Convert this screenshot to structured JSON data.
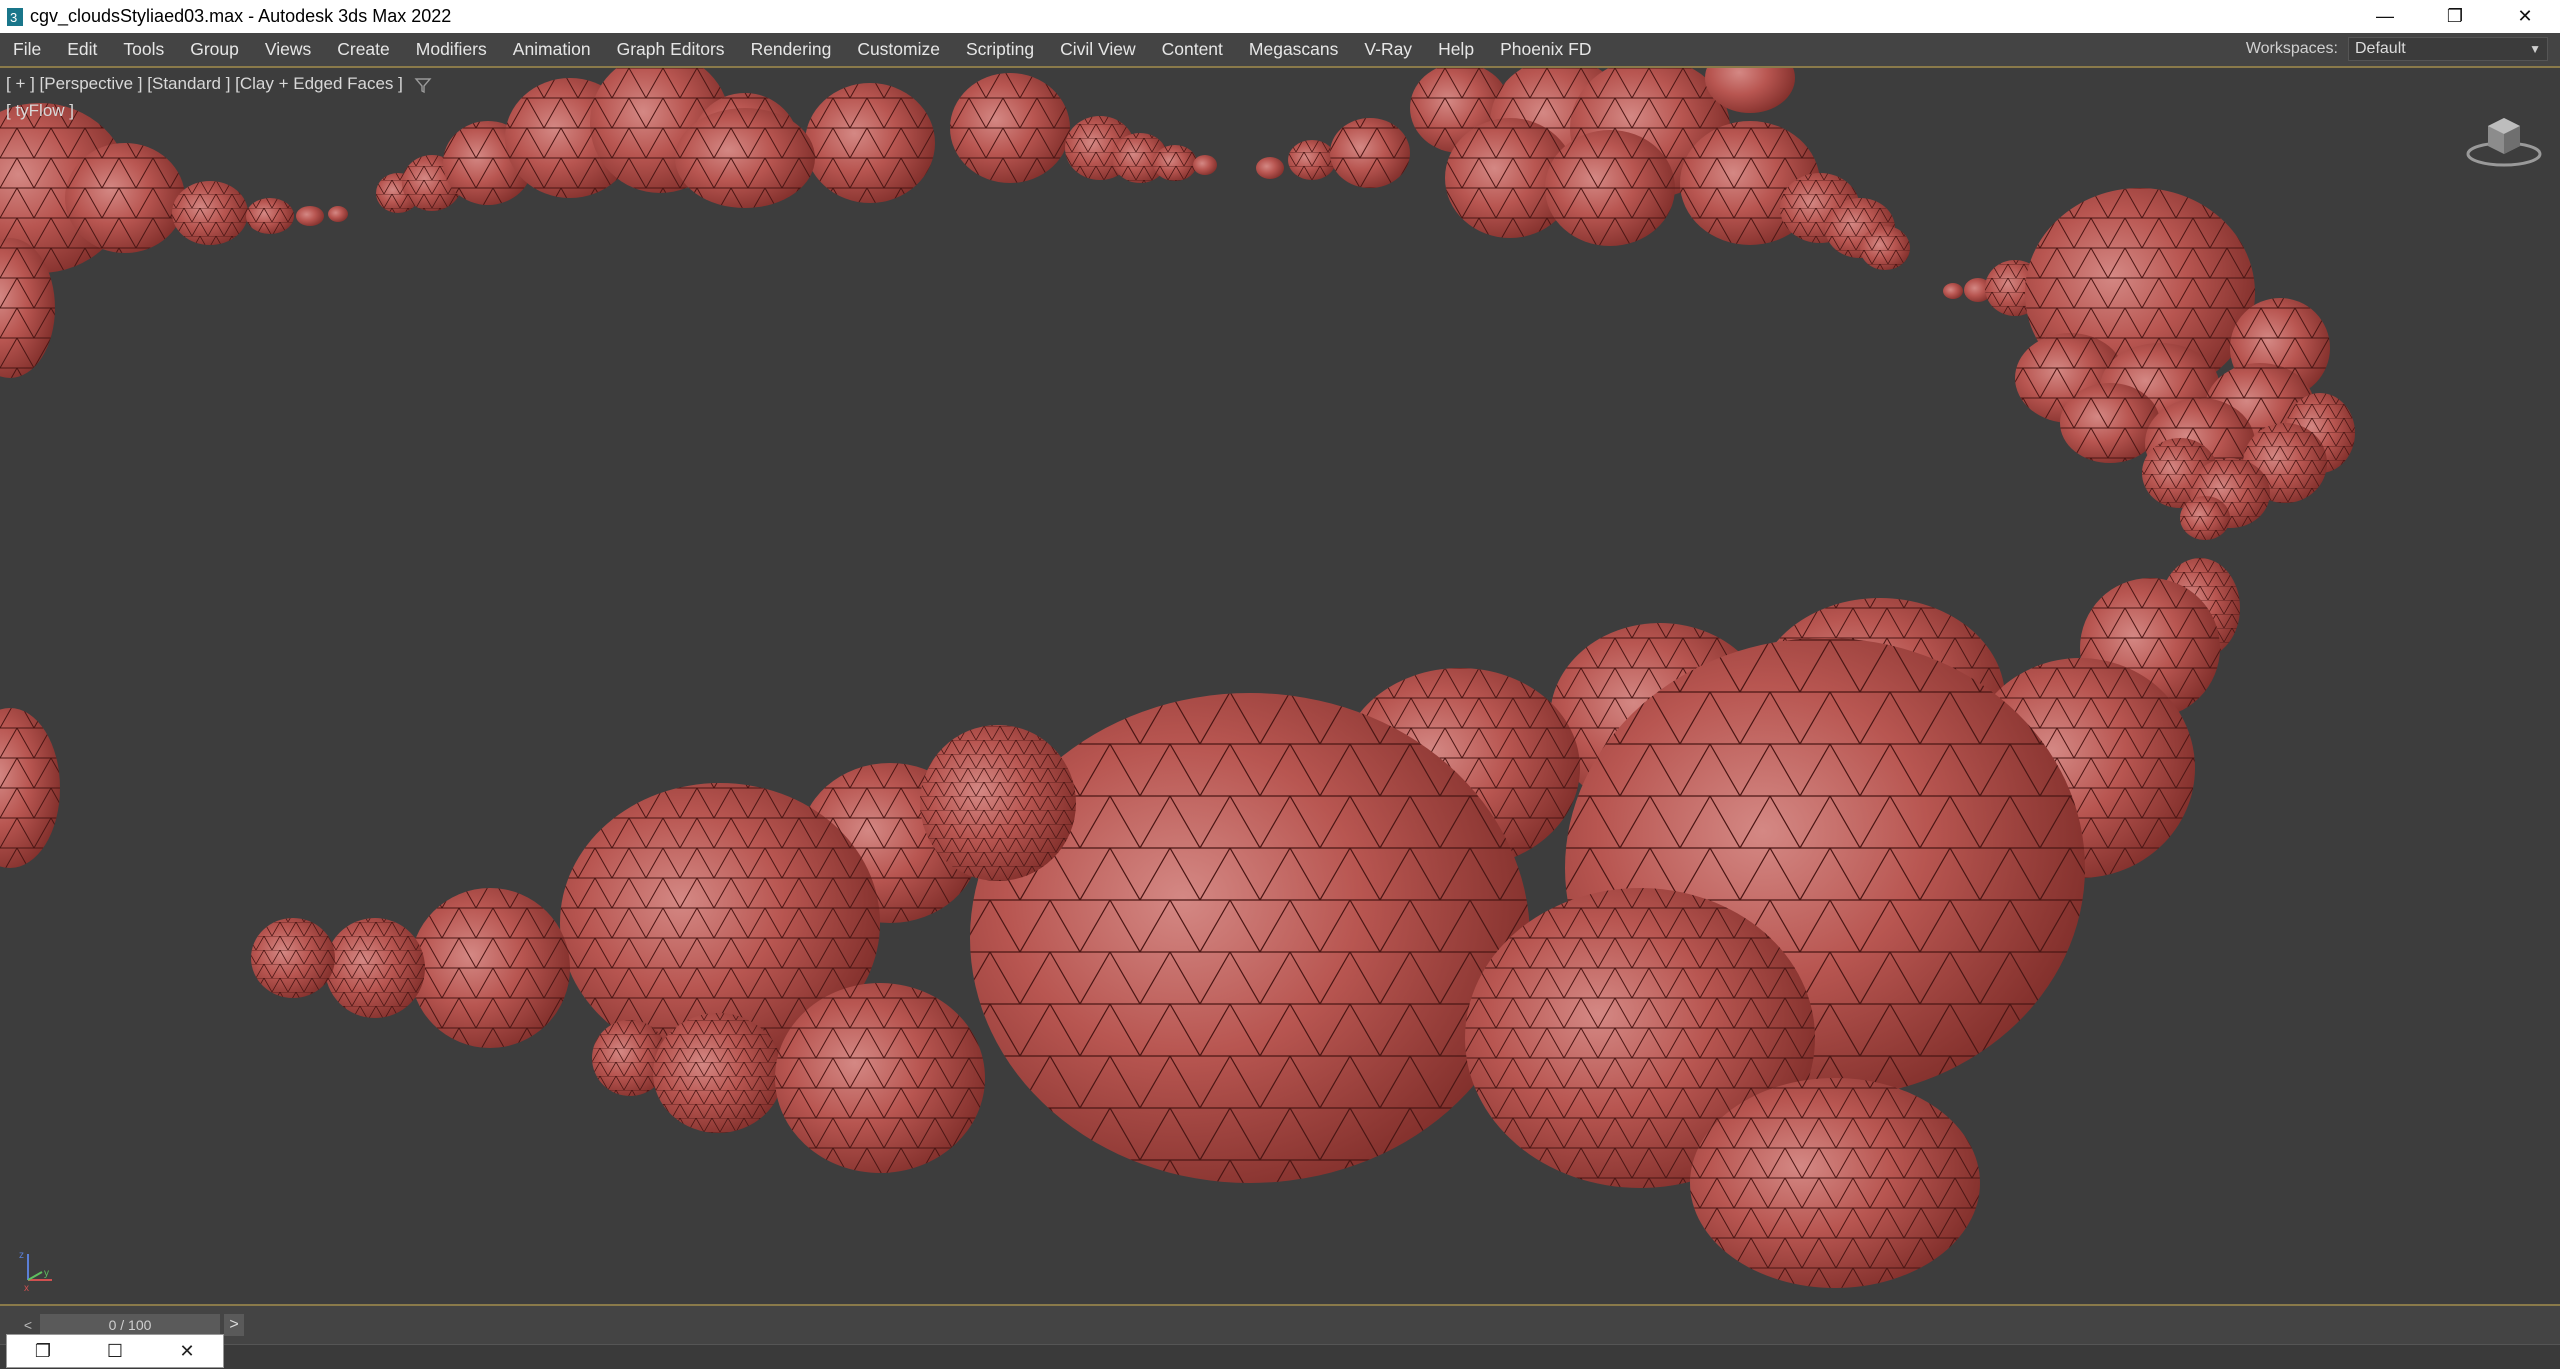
{
  "window": {
    "title": "cgv_cloudsStyliaed03.max - Autodesk 3ds Max 2022",
    "minimize": "—",
    "restore": "❐",
    "close": "✕"
  },
  "menu": {
    "items": [
      {
        "label": "File"
      },
      {
        "label": "Edit"
      },
      {
        "label": "Tools"
      },
      {
        "label": "Group"
      },
      {
        "label": "Views"
      },
      {
        "label": "Create"
      },
      {
        "label": "Modifiers"
      },
      {
        "label": "Animation"
      },
      {
        "label": "Graph Editors"
      },
      {
        "label": "Rendering"
      },
      {
        "label": "Customize"
      },
      {
        "label": "Scripting"
      },
      {
        "label": "Civil View"
      },
      {
        "label": "Content"
      },
      {
        "label": "Megascans"
      },
      {
        "label": "V-Ray"
      },
      {
        "label": "Help"
      },
      {
        "label": "Phoenix FD"
      }
    ],
    "workspaces_label": "Workspaces:",
    "workspaces_value": "Default"
  },
  "viewport": {
    "label": "[ + ] [Perspective ] [Standard ] [Clay + Edged Faces ]",
    "sub_label": "[ tyFlow ]",
    "axis_x": "x",
    "axis_y": "y",
    "axis_z": "z",
    "background_color": "#3d3d3d",
    "object_color": "#b5534b"
  },
  "timeline": {
    "frame": "0 / 100",
    "prev": "<",
    "next": ">"
  },
  "mini_window": {
    "restore": "❐",
    "maximize": "☐",
    "close": "✕"
  },
  "icons": [
    "app-3dsmax-icon",
    "filter-icon",
    "viewcube-icon",
    "axis-gizmo-icon"
  ]
}
